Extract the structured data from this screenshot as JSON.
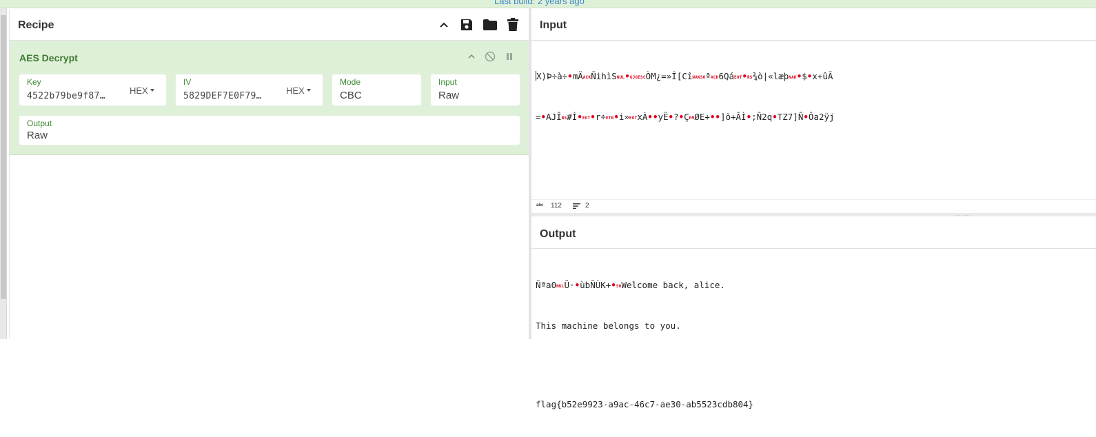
{
  "topbar": {
    "text": "Last build: 2 years ago"
  },
  "recipe": {
    "title": "Recipe",
    "icons": [
      "chevron-up-icon",
      "save-icon",
      "folder-icon",
      "trash-icon"
    ],
    "operation": {
      "name": "AES Decrypt",
      "key": {
        "label": "Key",
        "value": "4522b79be9f87…",
        "format": "HEX"
      },
      "iv": {
        "label": "IV",
        "value": "5829DEF7E0F79…",
        "format": "HEX"
      },
      "mode": {
        "label": "Mode",
        "value": "CBC"
      },
      "input": {
        "label": "Input",
        "value": "Raw"
      },
      "output": {
        "label": "Output",
        "value": "Raw"
      }
    }
  },
  "input_pane": {
    "title": "Input",
    "line1": [
      "X)Þ÷à÷",
      "•",
      "mÄ",
      "ACK",
      "ÑihìS",
      "NUL",
      "•",
      "GJG",
      "ESC",
      "ÒM¿=»Î[Cî",
      "NAK",
      "SO",
      "ª",
      "ACK",
      "6Qá",
      "EOT",
      "•",
      "RS",
      "¾ò|«læþ",
      "NAK",
      "•",
      "$",
      "•",
      "x+ûÃ"
    ],
    "line2": [
      "=",
      "•",
      "AJÎ",
      "BS",
      "#Í",
      "•",
      "EOT",
      "•",
      "r÷",
      "ETB",
      "•",
      "i»",
      "EOT",
      "xÀ",
      "••",
      "yË",
      "•",
      "?",
      "•",
      "Ç",
      "EM",
      "ØE+",
      "••",
      "]õ+ÃÌ",
      "•",
      ";Ñ2q",
      "•",
      "TZ7]Ñ",
      "•",
      "Ôa2ÿj"
    ],
    "status": {
      "length": "112",
      "lines": "2"
    }
  },
  "output_pane": {
    "title": "Output",
    "line1_prefix": [
      "Ñªa0",
      "NUL",
      "Ü·",
      "•",
      "ùbÑÙK+",
      "•",
      "SO"
    ],
    "line1_text": "Welcome back, alice.",
    "line2": "This machine belongs to you.",
    "line3": "",
    "line4": "flag{b52e9923-a9ac-46c7-ae30-ab5523cdb804}"
  }
}
